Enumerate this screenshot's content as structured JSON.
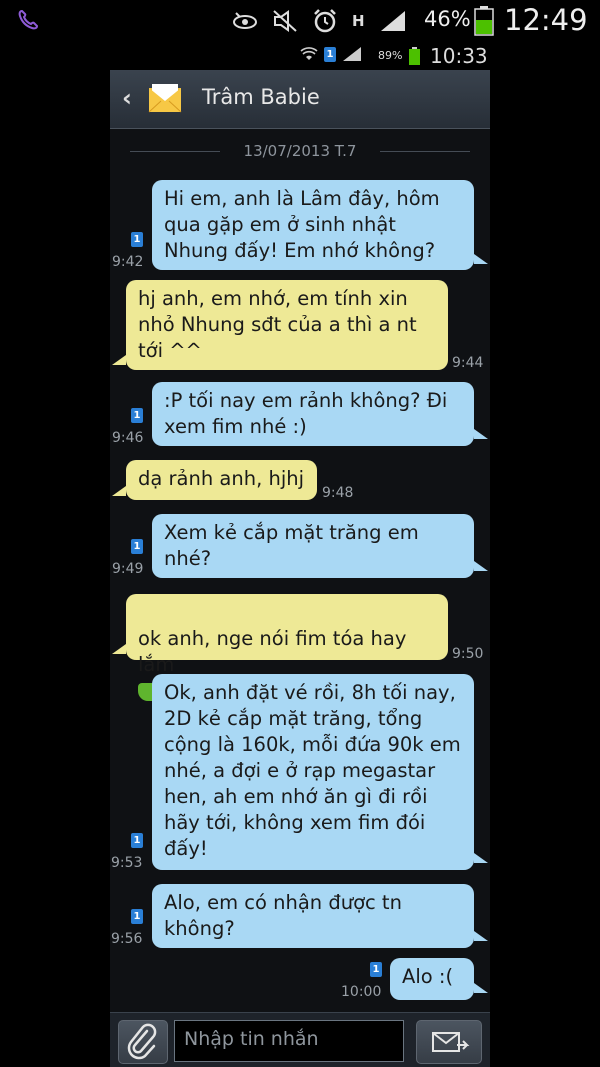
{
  "status_bar": {
    "battery_pct": "46%",
    "clock": "12:49",
    "net_label": "H"
  },
  "inner_status": {
    "sim": "1",
    "battery_pct": "89%",
    "clock": "10:33"
  },
  "title_bar": {
    "contact": "Trâm Babie",
    "back_icon": "chevron-left-icon",
    "contact_icon": "envelope-icon"
  },
  "date_separator": "13/07/2013 T.7",
  "messages": [
    {
      "dir": "sent",
      "text": "Hi em, anh là Lâm đây, hôm qua gặp em ở sinh nhật Nhung đấy! Em nhớ không?",
      "time": "9:42"
    },
    {
      "dir": "recv",
      "text": "hj anh, em nhớ, em tính xin nhỏ Nhung sđt của a thì a nt tới ^^",
      "time": "9:44"
    },
    {
      "dir": "sent",
      "text": ":P tối nay em rảnh không? Đi xem fim nhé :)",
      "time": "9:46"
    },
    {
      "dir": "recv",
      "text": "dạ rảnh anh, hjhj",
      "time": "9:48"
    },
    {
      "dir": "sent",
      "text": "Xem kẻ cắp mặt trăng em nhé?",
      "time": "9:49"
    },
    {
      "dir": "recv",
      "text": "ok anh, nge nói fim tóa hay lắm",
      "time": "9:50"
    },
    {
      "dir": "sent",
      "text": "Ok, anh đặt vé rồi, 8h tối nay, 2D kẻ cắp mặt trăng, tổng cộng là 160k, mỗi đứa 90k em nhé, a đợi e ở rạp megastar hen, ah em nhớ ăn gì đi rồi hãy tới, không xem fim đói đấy!",
      "time": "9:53"
    },
    {
      "dir": "sent",
      "text": "Alo, em có nhận được tn không?",
      "time": "9:56"
    },
    {
      "dir": "sent",
      "text": "Alo :(",
      "time": "10:00"
    }
  ],
  "sim_label": "1",
  "composer": {
    "placeholder": "Nhập tin nhắn",
    "attach_icon": "paperclip-icon",
    "send_icon": "send-envelope-icon"
  },
  "colors": {
    "sent_bubble": "#a9d8f4",
    "recv_bubble": "#eee996",
    "background": "#0f1114"
  }
}
